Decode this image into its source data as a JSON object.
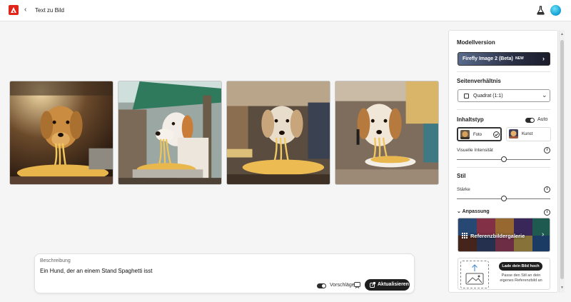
{
  "header": {
    "title": "Text zu Bild",
    "back_icon": "‹"
  },
  "prompt": {
    "label": "Beschreibung",
    "text": "Ein Hund, der an einem Stand Spaghetti isst",
    "suggestions_label": "Vorschläge",
    "suggestions_on": true,
    "update_label": "Aktualisieren"
  },
  "panel": {
    "model_heading": "Modellversion",
    "model_value": "Firefly Image 2 (Beta)",
    "model_badge": "NEW",
    "aspect_heading": "Seitenverhältnis",
    "aspect_value": "Quadrat (1:1)",
    "content_heading": "Inhaltstyp",
    "auto_label": "Auto",
    "auto_on": true,
    "content_options": [
      "Foto",
      "Kunst"
    ],
    "content_selected": "Foto",
    "intensity_label": "Visuelle Intensität",
    "intensity_value": 0.5,
    "style_heading": "Stil",
    "strength_label": "Stärke",
    "strength_value": 0.5,
    "customize_label": "Anpassung",
    "gallery_label": "Referenzbildergalerie",
    "upload_button": "Lade dein Bild hoch",
    "upload_text": "Passe den Stil an dein eigenes Referenzbild an"
  },
  "colors": {
    "brand": "#e1251b",
    "button_dark": "#1e1e1e",
    "background": "#f5f5f5"
  }
}
